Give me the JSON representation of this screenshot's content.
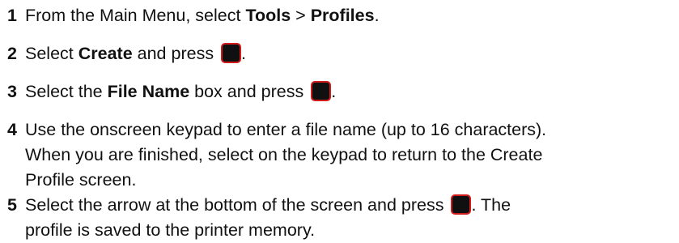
{
  "steps": [
    {
      "number": "1",
      "parts": [
        "From the Main Menu, select ",
        "Tools",
        " > ",
        "Profiles",
        "."
      ]
    },
    {
      "number": "2",
      "parts": [
        "Select ",
        "Create",
        " and press ",
        "."
      ]
    },
    {
      "number": "3",
      "parts": [
        "Select the ",
        "File Name",
        " box and press ",
        "."
      ]
    },
    {
      "number": "4",
      "lines": [
        "Use the onscreen keypad to enter a file name (up to 16 characters).",
        "When you are finished, select on the keypad to return to the Create",
        "Profile screen."
      ]
    },
    {
      "number": "5",
      "lines": [
        "Select the arrow at the bottom of the screen and press ",
        ". The",
        "profile is saved to the printer memory."
      ]
    }
  ],
  "icons": {
    "enter_key": "enter-key-icon",
    "key_color": "#101010",
    "key_border_color": "#d21c1c"
  }
}
